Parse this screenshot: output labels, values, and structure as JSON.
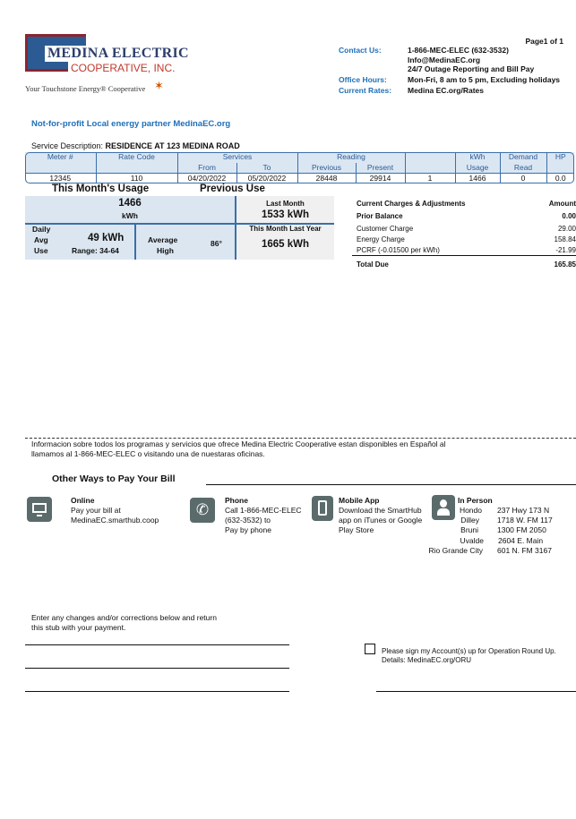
{
  "header": {
    "company_name_1": "MEDINA ELECTRIC",
    "company_name_2": "COOPERATIVE, INC.",
    "tagline": "Your Touchstone Energy® Cooperative",
    "page": "Page1 of 1",
    "contact_label": "Contact Us:",
    "contact_phone": "1-866-MEC-ELEC (632-3532)",
    "contact_email": "Info@MedinaEC.org",
    "contact_note": "24/7 Outage Reporting and Bill Pay",
    "hours_label": "Office Hours:",
    "hours_value": "Mon-Fri, 8 am to 5 pm, Excluding holidays",
    "rates_label": "Current Rates:",
    "rates_value": "Medina EC.org/Rates"
  },
  "slogan": "Not-for-profit Local energy partner MedinaEC.org",
  "service": {
    "label": "Service Description:",
    "value": "RESIDENCE AT 123 MEDINA ROAD"
  },
  "meter_table": {
    "headers": [
      "Meter #",
      "Rate Code",
      "Services",
      "Reading",
      "",
      "kWh",
      "Demand",
      "HP"
    ],
    "subheaders": [
      "",
      "",
      "From",
      "To",
      "Previous",
      "Present",
      "",
      "Usage",
      "Read",
      ""
    ],
    "row": [
      "12345",
      "110",
      "04/20/2022",
      "05/20/2022",
      "28448",
      "29914",
      "1",
      "1466",
      "0",
      "0.0"
    ]
  },
  "usage": {
    "this_month_title": "This Month's Usage",
    "previous_title": "Previous Use",
    "kwh_value": "1466",
    "kwh_unit": "kWh",
    "daily_1": "Daily",
    "daily_2": "Avg",
    "daily_3": "Use",
    "daily_avg": "49 kWh",
    "range": "Range: 34-64",
    "avg_high_1": "Average",
    "avg_high_2": "High",
    "avg_temp": "86°",
    "last_month_label": "Last Month",
    "last_month_value": "1533 kWh",
    "last_year_label": "This Month Last Year",
    "last_year_value": "1665 kWh"
  },
  "charges": {
    "header": "Current Charges & Adjustments",
    "amount_header": "Amount",
    "items": [
      {
        "label": "Prior Balance",
        "amount": "0.00"
      },
      {
        "label": "Customer Charge",
        "amount": "29.00"
      },
      {
        "label": "Energy Charge",
        "amount": "158.84"
      },
      {
        "label": "PCRF (-0.01500 per kWh)",
        "amount": "-21.99"
      }
    ],
    "total_label": "Total Due",
    "total": "165.85"
  },
  "spanish_1": "Informacion sobre todos los programas y servicios que ofrece Medina Electric Cooperative estan disponibles en Español al",
  "spanish_2": "llamamos al 1-866-MEC-ELEC o visitando una de nuestaras oficinas.",
  "pay": {
    "title": "Other Ways to Pay Your Bill",
    "online": {
      "title": "Online",
      "l1": "Pay your bill at",
      "l2": "MedinaEC.smarthub.coop"
    },
    "phone": {
      "title": "Phone",
      "l1": "Call 1-866-MEC-ELEC",
      "l2": "(632-3532) to",
      "l3": "Pay by phone"
    },
    "mobile": {
      "title": "Mobile App",
      "l1": "Download the SmartHub",
      "l2": "app on iTunes or Google",
      "l3": "Play Store"
    },
    "person": {
      "title": "In Person",
      "offices": [
        {
          "city": "Hondo",
          "address": "237 Hwy 173 N"
        },
        {
          "city": "Dilley",
          "address": "1718 W. FM 117"
        },
        {
          "city": "Bruni",
          "address": "1300 FM 2050"
        },
        {
          "city": "Uvalde",
          "address": "2604 E. Main"
        },
        {
          "city": "Rio Grande City",
          "address": "601 N. FM 3167"
        }
      ]
    }
  },
  "stub": {
    "l1": "Enter any changes and/or corrections below and return",
    "l2": "this stub with your payment.",
    "roundup_1": "Please sign my Account(s) up for Operation Round Up.",
    "roundup_2": "Details: MedinaEC.org/ORU"
  },
  "colors": {
    "accent_blue": "#1f6fb8",
    "logo_red": "#8b2530",
    "logo_blue": "#2c5b93",
    "panel_blue": "#dbe6f1",
    "icon_gray": "#5b6b6b"
  }
}
